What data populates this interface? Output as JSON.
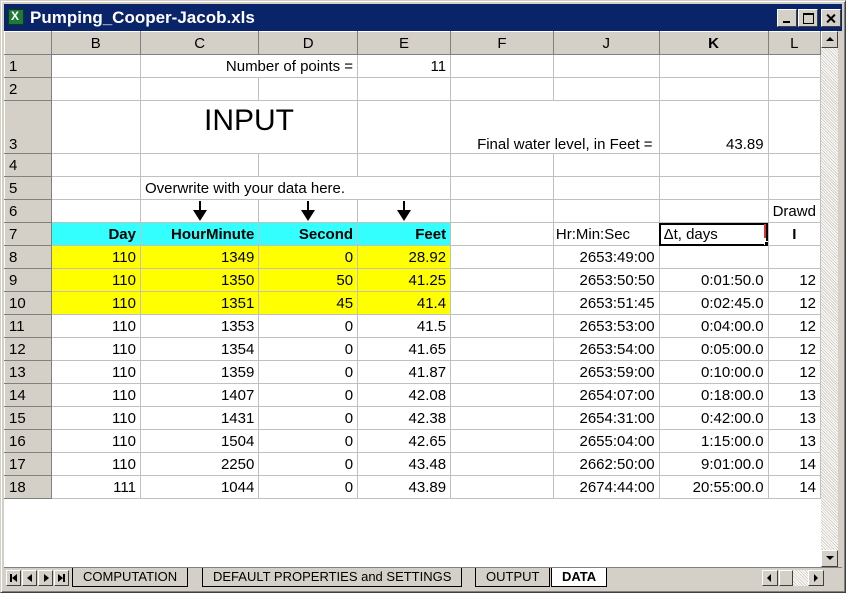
{
  "window": {
    "title": "Pumping_Cooper-Jacob.xls",
    "colors": {
      "titlebar": "#0a246a",
      "header_cyan": "#33ffff",
      "input_yellow": "#ffff00"
    }
  },
  "columns": [
    "B",
    "C",
    "D",
    "E",
    "F",
    "J",
    "K",
    "L"
  ],
  "active_column": "K",
  "rows": {
    "r1": {
      "num": "1",
      "label": "Number of points =",
      "value": "11"
    },
    "r2": {
      "num": "2"
    },
    "r3": {
      "num": "3",
      "title": "INPUT",
      "final_label": "Final water level, in Feet  =",
      "final_value": "43.89"
    },
    "r4": {
      "num": "4"
    },
    "r5": {
      "num": "5",
      "note": "Overwrite with your data here."
    },
    "r6": {
      "num": "6",
      "drawdown_partial": "Drawd"
    },
    "r7": {
      "num": "7",
      "headers": [
        "Day",
        "HourMinute",
        "Second",
        "Feet"
      ],
      "hms_label": "Hr:Min:Sec",
      "dt_label": "Δt, days",
      "l_partial": "I"
    }
  },
  "data_rows": [
    {
      "num": "8",
      "day": "110",
      "hm": "1349",
      "sec": "0",
      "feet": "28.92",
      "hms": "2653:49:00",
      "dt": "",
      "l": "",
      "yellow": true
    },
    {
      "num": "9",
      "day": "110",
      "hm": "1350",
      "sec": "50",
      "feet": "41.25",
      "hms": "2653:50:50",
      "dt": "0:01:50.0",
      "l": "12",
      "yellow": true
    },
    {
      "num": "10",
      "day": "110",
      "hm": "1351",
      "sec": "45",
      "feet": "41.4",
      "hms": "2653:51:45",
      "dt": "0:02:45.0",
      "l": "12",
      "yellow": true
    },
    {
      "num": "11",
      "day": "110",
      "hm": "1353",
      "sec": "0",
      "feet": "41.5",
      "hms": "2653:53:00",
      "dt": "0:04:00.0",
      "l": "12",
      "yellow": false
    },
    {
      "num": "12",
      "day": "110",
      "hm": "1354",
      "sec": "0",
      "feet": "41.65",
      "hms": "2653:54:00",
      "dt": "0:05:00.0",
      "l": "12",
      "yellow": false
    },
    {
      "num": "13",
      "day": "110",
      "hm": "1359",
      "sec": "0",
      "feet": "41.87",
      "hms": "2653:59:00",
      "dt": "0:10:00.0",
      "l": "12",
      "yellow": false
    },
    {
      "num": "14",
      "day": "110",
      "hm": "1407",
      "sec": "0",
      "feet": "42.08",
      "hms": "2654:07:00",
      "dt": "0:18:00.0",
      "l": "13",
      "yellow": false
    },
    {
      "num": "15",
      "day": "110",
      "hm": "1431",
      "sec": "0",
      "feet": "42.38",
      "hms": "2654:31:00",
      "dt": "0:42:00.0",
      "l": "13",
      "yellow": false
    },
    {
      "num": "16",
      "day": "110",
      "hm": "1504",
      "sec": "0",
      "feet": "42.65",
      "hms": "2655:04:00",
      "dt": "1:15:00.0",
      "l": "13",
      "yellow": false
    },
    {
      "num": "17",
      "day": "110",
      "hm": "2250",
      "sec": "0",
      "feet": "43.48",
      "hms": "2662:50:00",
      "dt": "9:01:00.0",
      "l": "14",
      "yellow": false
    },
    {
      "num": "18",
      "day": "111",
      "hm": "1044",
      "sec": "0",
      "feet": "43.89",
      "hms": "2674:44:00",
      "dt": "20:55:00.0",
      "l": "14",
      "yellow": false
    }
  ],
  "tabs": [
    {
      "label": "COMPUTATION",
      "active": false
    },
    {
      "label": "DEFAULT PROPERTIES and SETTINGS",
      "active": false
    },
    {
      "label": "OUTPUT",
      "active": false
    },
    {
      "label": "DATA",
      "active": true
    }
  ],
  "icons": {
    "app": "excel-icon",
    "minimize": "minimize-icon",
    "maximize": "maximize-icon",
    "close": "close-icon",
    "first_sheet": "first-sheet-icon",
    "prev_sheet": "prev-sheet-icon",
    "next_sheet": "next-sheet-icon",
    "last_sheet": "last-sheet-icon",
    "arrow": "down-arrow-icon"
  }
}
